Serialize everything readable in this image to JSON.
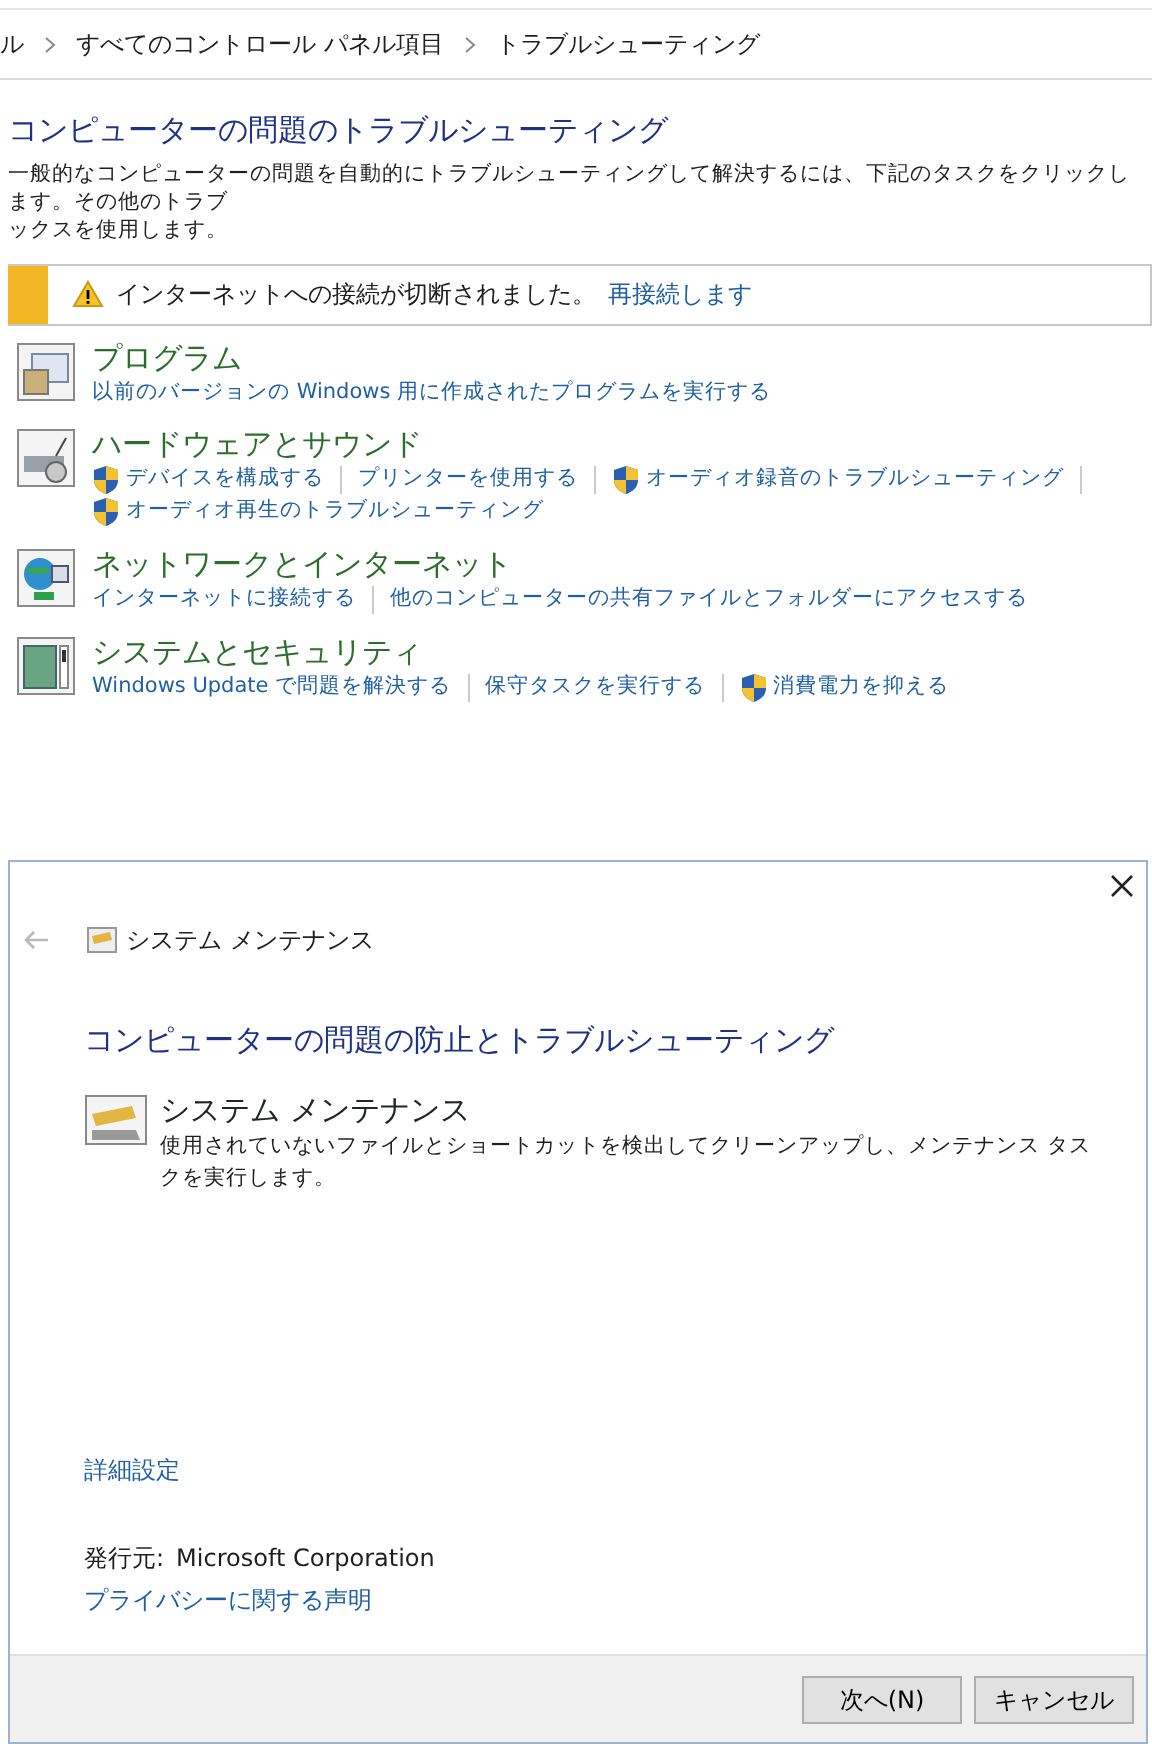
{
  "breadcrumb": [
    "ル",
    "すべてのコントロール パネル項目",
    "トラブルシューティング"
  ],
  "page": {
    "title": "コンピューターの問題のトラブルシューティング",
    "description": [
      "一般的なコンピューターの問題を自動的にトラブルシューティングして解決するには、下記のタスクをクリックします。その他のトラブ",
      "ックスを使用します。"
    ]
  },
  "notice": {
    "message": "インターネットへの接続が切断されました。",
    "link": "再接続します"
  },
  "categories": [
    {
      "title": "プログラム",
      "links": [
        {
          "text": "以前のバージョンの Windows 用に作成されたプログラムを実行する",
          "shield": false
        }
      ]
    },
    {
      "title": "ハードウェアとサウンド",
      "links": [
        {
          "text": "デバイスを構成する",
          "shield": true
        },
        {
          "text": "プリンターを使用する",
          "shield": false
        },
        {
          "text": "オーディオ録音のトラブルシューティング",
          "shield": true
        },
        {
          "text": "オーディオ再生のトラブルシューティング",
          "shield": true
        }
      ]
    },
    {
      "title": "ネットワークとインターネット",
      "links": [
        {
          "text": "インターネットに接続する",
          "shield": false
        },
        {
          "text": "他のコンピューターの共有ファイルとフォルダーにアクセスする",
          "shield": false
        }
      ]
    },
    {
      "title": "システムとセキュリティ",
      "links": [
        {
          "text": "Windows Update で問題を解決する",
          "shield": false
        },
        {
          "text": "保守タスクを実行する",
          "shield": false
        },
        {
          "text": "消費電力を抑える",
          "shield": true
        }
      ]
    }
  ],
  "dialog": {
    "nav_title": "システム メンテナンス",
    "back_enabled": false,
    "heading": "コンピューターの問題の防止とトラブルシューティング",
    "items": [
      {
        "title": "システム メンテナンス",
        "description": "使用されていないファイルとショートカットを検出してクリーンアップし、メンテナンス タスクを実行します。"
      }
    ],
    "advanced_link": "詳細設定",
    "publisher": {
      "label": "発行元:",
      "value": "Microsoft Corporation"
    },
    "privacy_link": "プライバシーに関する声明",
    "buttons": [
      {
        "label": "次へ(N)"
      },
      {
        "label": "キャンセル"
      }
    ]
  }
}
